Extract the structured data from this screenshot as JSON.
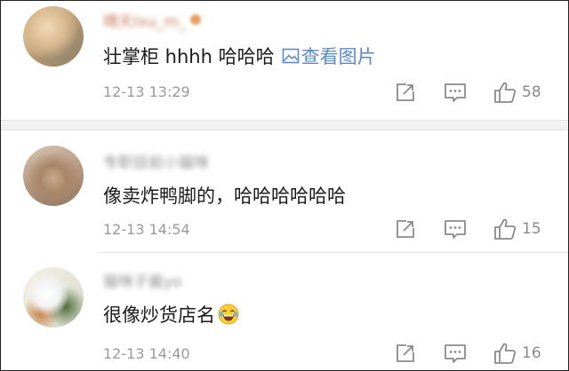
{
  "comments": [
    {
      "username": "晴天Ixu_m_",
      "text": "壮掌柜 hhhh 哈哈哈",
      "link_label": "查看图片",
      "time": "12-13 13:29",
      "likes": "58"
    },
    {
      "username": "专职目前小猫咪",
      "text": "像卖炸鸭脚的，哈哈哈哈哈哈",
      "time": "12-13 14:54",
      "likes": "15"
    },
    {
      "username": "猫咪子酱yo",
      "text": "很像炒货店名",
      "emoji": "laughing-tears-emoji",
      "time": "12-13 14:40",
      "likes": "16"
    }
  ],
  "icons": {
    "forward": "forward-icon",
    "comment": "comment-icon",
    "like": "thumbs-up-icon",
    "image": "image-icon"
  },
  "colors": {
    "link": "#5a8bc3",
    "meta": "#9a9a9a",
    "text": "#1a1a1a",
    "icon": "#8a8a8a"
  }
}
